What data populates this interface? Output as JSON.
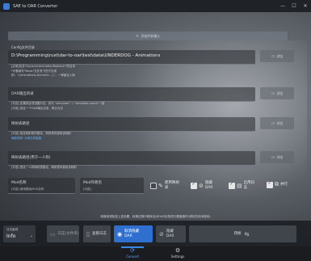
{
  "window": {
    "title": "SAE to OAR Converter",
    "controls": [
      "—",
      "☐",
      "✕"
    ]
  },
  "top_button": {
    "label": "添加代码输入",
    "icon": "plus-icon"
  },
  "dir_section": {
    "label": "Config文件目录",
    "value": "D:\\Programming\\rust\\dar-to-oar\\test\\data\\UNDERDOG - Animations",
    "browse": "浏览",
    "help_lines": [
      "[必填]包含\"DynamicAnimationReplacer\"的目录",
      "*不要填写\"Mods\"文件夹下的子目录",
      "例：\"{Animations,Dynamic...}\"，一律留全入局"
    ]
  },
  "oar_section": {
    "label": "OAR输出目录",
    "browse": "浏览",
    "help_lines": [
      "[可选] 如果将此项设置为空，则与 \"template\" = \"template-name\"一致",
      "[可选] 指定一个OAR输出目录，默认为空"
    ]
  },
  "mapping_section": {
    "label": "映射表路径",
    "browse": "浏览",
    "help_lines": [
      "[可选] 指定映射表的路径，映射表将使用该映射"
    ],
    "link_text": "映射说明: 示例文件链接"
  },
  "mapping1_section": {
    "label": "映射表路径(用于一人称)",
    "browse": "浏览",
    "help_lines": [
      "[可选] 指定一人称映射表路径，映射表将使用该映射"
    ]
  },
  "mod_name": {
    "label": "Mod名称",
    "sub": "[可选] 使用原始MOD名称"
  },
  "mod_author": {
    "label": "Mod作者名",
    "sub": "[可选]"
  },
  "checkboxes": [
    {
      "label": "使用映射\n表",
      "checked": false
    },
    {
      "label": "隐藏\nDAR",
      "checked": true,
      "icon": "eye-off-icon"
    },
    {
      "label": "启用日\n志",
      "checked": true,
      "icon": "log-icon"
    },
    {
      "label": "并行",
      "checked": true,
      "icon": "parallel-icon"
    }
  ],
  "warning": "转换前请检查上述设置，转换过程中程序会对OAR目录进行覆盖操作(请勿关闭本程序)",
  "bottom": {
    "log_level_caption": "日志级别",
    "log_level": "Info",
    "buttons": [
      {
        "label": "日志(文件夹)",
        "icon": "folder-icon",
        "style": "dim"
      },
      {
        "label": "查看日志",
        "icon": "document-icon",
        "style": "normal"
      },
      {
        "label": "取消隐藏\nDAR",
        "icon": "eye-icon",
        "style": "blue"
      },
      {
        "label": "隐藏\nDAR",
        "icon": "eye-off-icon",
        "style": "normal"
      },
      {
        "label": "转换",
        "icon": "convert-icon",
        "style": "normal"
      }
    ]
  },
  "nav": [
    {
      "label": "Convert",
      "icon": "sync-icon",
      "active": true
    },
    {
      "label": "Settings",
      "icon": "gear-icon",
      "active": false
    }
  ]
}
